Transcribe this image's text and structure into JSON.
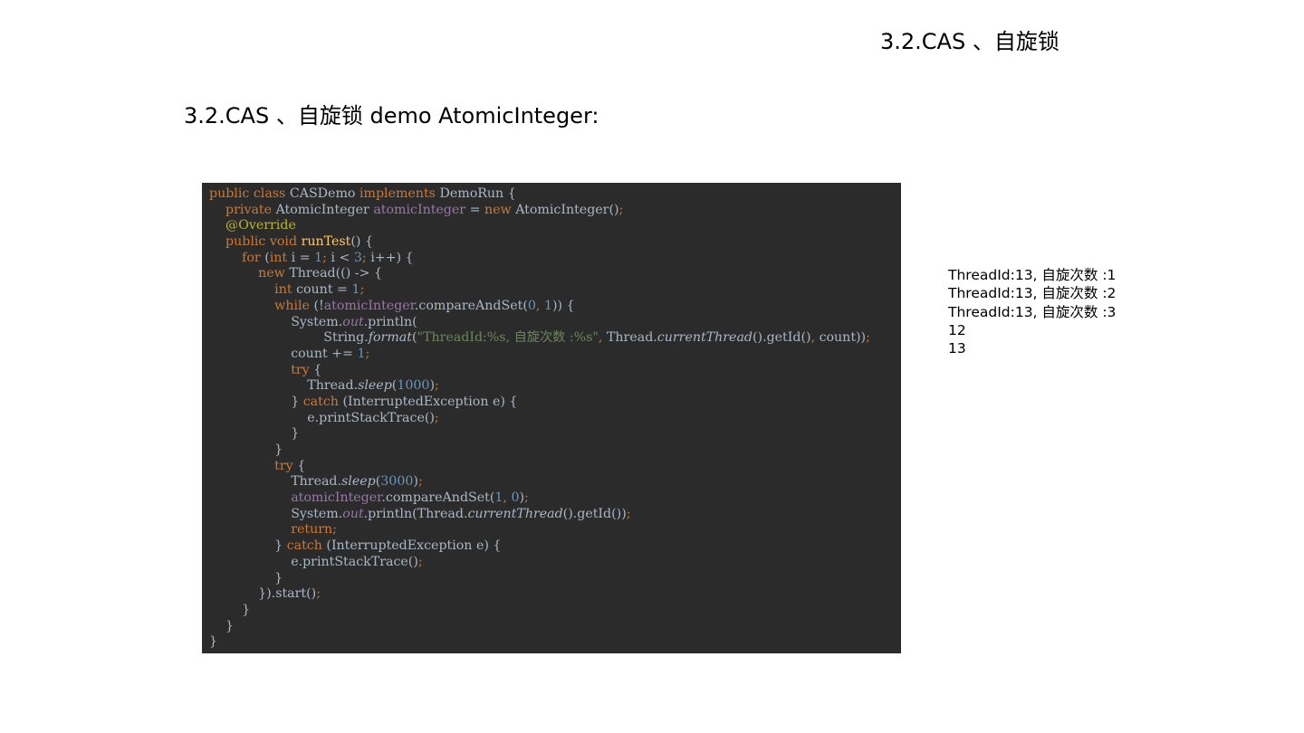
{
  "header": {
    "title": "3.2.CAS 、自旋锁"
  },
  "main": {
    "heading": "3.2.CAS 、自旋锁  demo AtomicInteger:"
  },
  "code": {
    "lines": [
      [
        [
          "kw",
          "public class "
        ],
        [
          "plain",
          "CASDemo "
        ],
        [
          "kw",
          "implements "
        ],
        [
          "plain",
          "DemoRun {"
        ]
      ],
      [
        [
          "plain",
          "    "
        ],
        [
          "kw",
          "private "
        ],
        [
          "plain",
          "AtomicInteger "
        ],
        [
          "field",
          "atomicInteger"
        ],
        [
          "plain",
          " = "
        ],
        [
          "kw",
          "new "
        ],
        [
          "plain",
          "AtomicInteger()"
        ],
        [
          "punct",
          ";"
        ]
      ],
      [
        [
          "plain",
          "    "
        ],
        [
          "ann",
          "@Override"
        ]
      ],
      [
        [
          "plain",
          "    "
        ],
        [
          "kw",
          "public void "
        ],
        [
          "method",
          "runTest"
        ],
        [
          "plain",
          "() {"
        ]
      ],
      [
        [
          "plain",
          "        "
        ],
        [
          "kw",
          "for "
        ],
        [
          "plain",
          "("
        ],
        [
          "kw",
          "int "
        ],
        [
          "plain",
          "i = "
        ],
        [
          "num",
          "1"
        ],
        [
          "punct",
          "; "
        ],
        [
          "plain",
          "i < "
        ],
        [
          "num",
          "3"
        ],
        [
          "punct",
          "; "
        ],
        [
          "plain",
          "i++) {"
        ]
      ],
      [
        [
          "plain",
          "            "
        ],
        [
          "kw",
          "new "
        ],
        [
          "plain",
          "Thread(() -> {"
        ]
      ],
      [
        [
          "plain",
          "                "
        ],
        [
          "kw",
          "int "
        ],
        [
          "plain",
          "count = "
        ],
        [
          "num",
          "1"
        ],
        [
          "punct",
          ";"
        ]
      ],
      [
        [
          "plain",
          "                "
        ],
        [
          "kw",
          "while "
        ],
        [
          "plain",
          "(!"
        ],
        [
          "field",
          "atomicInteger"
        ],
        [
          "plain",
          ".compareAndSet("
        ],
        [
          "num",
          "0"
        ],
        [
          "punct",
          ", "
        ],
        [
          "num",
          "1"
        ],
        [
          "plain",
          ")) {"
        ]
      ],
      [
        [
          "plain",
          "                    System."
        ],
        [
          "static",
          "out"
        ],
        [
          "plain",
          ".println("
        ]
      ],
      [
        [
          "plain",
          "                            String."
        ],
        [
          "italic",
          "format"
        ],
        [
          "plain",
          "("
        ],
        [
          "str",
          "\"ThreadId:%s, 自旋次数 :%s\""
        ],
        [
          "punct",
          ", "
        ],
        [
          "plain",
          "Thread."
        ],
        [
          "italic",
          "currentThread"
        ],
        [
          "plain",
          "().getId()"
        ],
        [
          "punct",
          ", "
        ],
        [
          "plain",
          "count))"
        ],
        [
          "punct",
          ";"
        ]
      ],
      [
        [
          "plain",
          "                    count += "
        ],
        [
          "num",
          "1"
        ],
        [
          "punct",
          ";"
        ]
      ],
      [
        [
          "plain",
          "                    "
        ],
        [
          "kw",
          "try "
        ],
        [
          "plain",
          "{"
        ]
      ],
      [
        [
          "plain",
          "                        Thread."
        ],
        [
          "italic",
          "sleep"
        ],
        [
          "plain",
          "("
        ],
        [
          "num",
          "1000"
        ],
        [
          "plain",
          ")"
        ],
        [
          "punct",
          ";"
        ]
      ],
      [
        [
          "plain",
          "                    } "
        ],
        [
          "kw",
          "catch "
        ],
        [
          "plain",
          "(InterruptedException e) {"
        ]
      ],
      [
        [
          "plain",
          "                        e.printStackTrace()"
        ],
        [
          "punct",
          ";"
        ]
      ],
      [
        [
          "plain",
          "                    }"
        ]
      ],
      [
        [
          "plain",
          "                }"
        ]
      ],
      [
        [
          "plain",
          "                "
        ],
        [
          "kw",
          "try "
        ],
        [
          "plain",
          "{"
        ]
      ],
      [
        [
          "plain",
          "                    Thread."
        ],
        [
          "italic",
          "sleep"
        ],
        [
          "plain",
          "("
        ],
        [
          "num",
          "3000"
        ],
        [
          "plain",
          ")"
        ],
        [
          "punct",
          ";"
        ]
      ],
      [
        [
          "plain",
          "                    "
        ],
        [
          "field",
          "atomicInteger"
        ],
        [
          "plain",
          ".compareAndSet("
        ],
        [
          "num",
          "1"
        ],
        [
          "punct",
          ", "
        ],
        [
          "num",
          "0"
        ],
        [
          "plain",
          ")"
        ],
        [
          "punct",
          ";"
        ]
      ],
      [
        [
          "plain",
          "                    System."
        ],
        [
          "static",
          "out"
        ],
        [
          "plain",
          ".println(Thread."
        ],
        [
          "italic",
          "currentThread"
        ],
        [
          "plain",
          "().getId())"
        ],
        [
          "punct",
          ";"
        ]
      ],
      [
        [
          "plain",
          "                    "
        ],
        [
          "kw",
          "return"
        ],
        [
          "punct",
          ";"
        ]
      ],
      [
        [
          "plain",
          "                } "
        ],
        [
          "kw",
          "catch "
        ],
        [
          "plain",
          "(InterruptedException e) {"
        ]
      ],
      [
        [
          "plain",
          "                    e.printStackTrace()"
        ],
        [
          "punct",
          ";"
        ]
      ],
      [
        [
          "plain",
          "                }"
        ]
      ],
      [
        [
          "plain",
          "            }).start()"
        ],
        [
          "punct",
          ";"
        ]
      ],
      [
        [
          "plain",
          "        }"
        ]
      ],
      [
        [
          "plain",
          "    }"
        ]
      ],
      [
        [
          "plain",
          "}"
        ]
      ]
    ]
  },
  "output": {
    "lines": [
      "ThreadId:13, 自旋次数 :1",
      "ThreadId:13, 自旋次数 :2",
      "ThreadId:13, 自旋次数 :3",
      "12",
      "13"
    ]
  },
  "colors": {
    "code_background": "#2b2b2b",
    "code_plain": "#a9b7c6",
    "code_keyword": "#cc7832",
    "code_annotation": "#bbb529",
    "code_field": "#9876aa",
    "code_number": "#6897bb",
    "code_string": "#6a8759",
    "code_method": "#ffc66d"
  }
}
